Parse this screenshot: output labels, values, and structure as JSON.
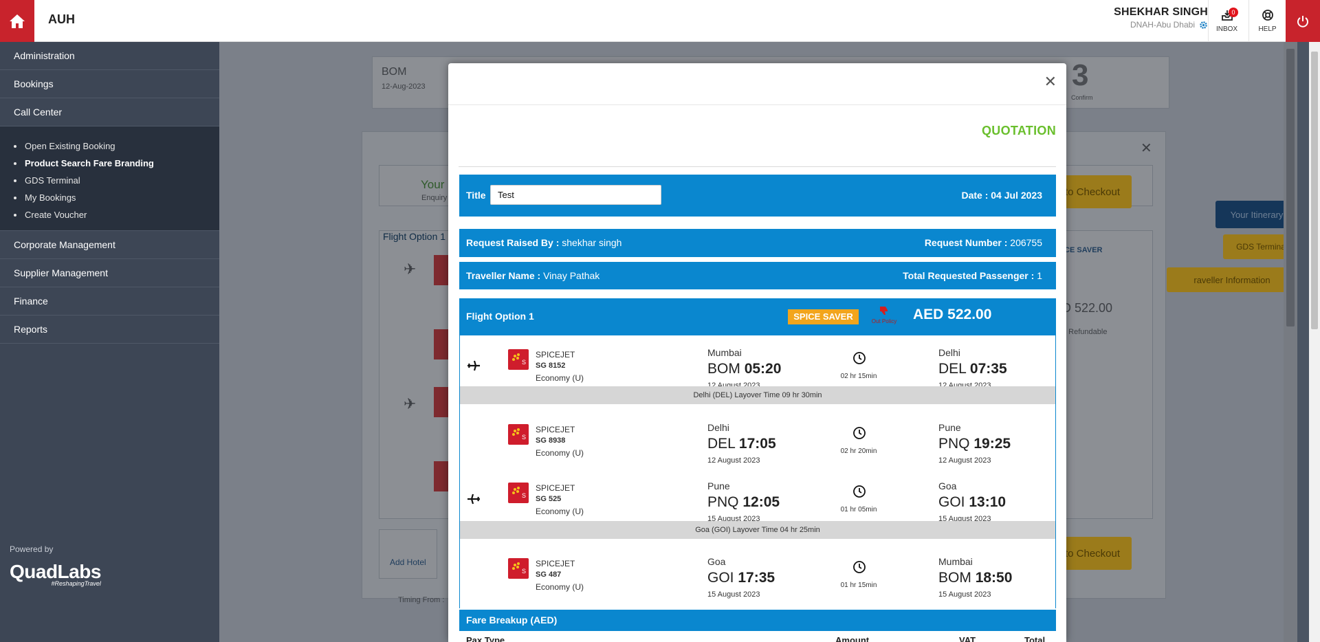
{
  "header": {
    "app_code": "AUH",
    "user_name": "SHEKHAR SINGH",
    "user_branch": "DNAH-Abu Dhabi",
    "inbox_label": "INBOX",
    "inbox_count": "0",
    "help_label": "HELP",
    "brand_color": "#c8232c"
  },
  "sidebar": {
    "items": [
      {
        "label": "Administration"
      },
      {
        "label": "Bookings"
      },
      {
        "label": "Call Center"
      }
    ],
    "call_center_sub": [
      {
        "label": "Open Existing Booking"
      },
      {
        "label": "Product Search Fare Branding",
        "active": true
      },
      {
        "label": "GDS Terminal"
      },
      {
        "label": "My Bookings"
      },
      {
        "label": "Create Voucher"
      }
    ],
    "items_after": [
      {
        "label": "Corporate Management"
      },
      {
        "label": "Supplier Management"
      },
      {
        "label": "Finance"
      },
      {
        "label": "Reports"
      }
    ],
    "powered_by": "Powered by",
    "brand": "QuadLabs",
    "brand_tag": "#ReshapingTravel"
  },
  "background": {
    "origin": "BOM",
    "origin_date": "12-Aug-2023",
    "step_number": "3",
    "step_label": "Confirm",
    "your_text": "Your",
    "enquiry_text": "Enquiry",
    "flight_option_tab": "Flight Option 1",
    "checkout_label": "to Checkout",
    "itinerary_label": "Your Itinerary",
    "gds_label": "GDS Termina",
    "traveller_info": "raveller Information",
    "spice_saver": "ICE SAVER",
    "price_partial": "D 522.00",
    "refund_partial": "n Refundable",
    "add_hotel": "Add Hotel",
    "timing_from": "Timing From :"
  },
  "modal": {
    "heading": "QUOTATION",
    "title_label": "Title",
    "title_value": "Test",
    "date_text": "Date : 04 Jul 2023",
    "request_raised_label": "Request Raised By :",
    "request_raised_value": "shekhar singh",
    "request_number_label": "Request Number :",
    "request_number_value": "206755",
    "traveller_label": "Traveller Name :",
    "traveller_value": "Vinay Pathak",
    "passenger_label": "Total Requested Passenger :",
    "passenger_value": "1",
    "flight_option_label": "Flight Option 1",
    "fare_brand": "SPICE SAVER",
    "out_policy": "Out Policy",
    "price": "AED 522.00",
    "segments": [
      {
        "airline": "SPICEJET",
        "flight": "SG 8152",
        "cabin": "Economy (U)",
        "dep_city": "Mumbai",
        "dep_code": "BOM",
        "dep_time": "05:20",
        "dep_date": "12 August 2023",
        "duration": "02 hr 15min",
        "arr_city": "Delhi",
        "arr_code": "DEL",
        "arr_time": "07:35",
        "arr_date": "12 August 2023"
      },
      {
        "airline": "SPICEJET",
        "flight": "SG 8938",
        "cabin": "Economy (U)",
        "dep_city": "Delhi",
        "dep_code": "DEL",
        "dep_time": "17:05",
        "dep_date": "12 August 2023",
        "duration": "02 hr 20min",
        "arr_city": "Pune",
        "arr_code": "PNQ",
        "arr_time": "19:25",
        "arr_date": "12 August 2023"
      },
      {
        "airline": "SPICEJET",
        "flight": "SG 525",
        "cabin": "Economy (U)",
        "dep_city": "Pune",
        "dep_code": "PNQ",
        "dep_time": "12:05",
        "dep_date": "15 August 2023",
        "duration": "01 hr 05min",
        "arr_city": "Goa",
        "arr_code": "GOI",
        "arr_time": "13:10",
        "arr_date": "15 August 2023"
      },
      {
        "airline": "SPICEJET",
        "flight": "SG 487",
        "cabin": "Economy (U)",
        "dep_city": "Goa",
        "dep_code": "GOI",
        "dep_time": "17:35",
        "dep_date": "15 August 2023",
        "duration": "01 hr 15min",
        "arr_city": "Mumbai",
        "arr_code": "BOM",
        "arr_time": "18:50",
        "arr_date": "15 August 2023"
      }
    ],
    "layover_1": "Delhi (DEL) Layover Time 09 hr 30min",
    "layover_2": "Goa (GOI) Layover Time 04 hr 25min",
    "fare_breakup_label": "Fare Breakup (AED)",
    "fare_cols": {
      "pax_type": "Pax Type",
      "amount": "Amount",
      "vat": "VAT",
      "total": "Total"
    },
    "accent_color": "#0a87cf",
    "heading_color": "#6abf2d"
  }
}
